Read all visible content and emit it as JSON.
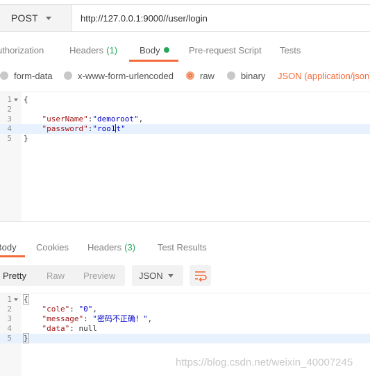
{
  "request": {
    "method": "POST",
    "url": "http://127.0.0.1:9000//user/login",
    "tabs": [
      {
        "label": "uthorization"
      },
      {
        "label": "Headers",
        "count": "(1)"
      },
      {
        "label": "Body"
      },
      {
        "label": "Pre-request Script"
      },
      {
        "label": "Tests"
      }
    ],
    "body_types": [
      "form-data",
      "x-www-form-urlencoded",
      "raw",
      "binary"
    ],
    "selected_body_type": "raw",
    "content_type": "JSON (application/json)",
    "editor": {
      "line_numbers": [
        "1",
        "2",
        "3",
        "4",
        "5"
      ],
      "brace_open": "{",
      "brace_close": "}",
      "user_key": "\"userName\"",
      "user_value": "\"demoroot\"",
      "pass_key": "\"password\"",
      "pass_value_before_cursor": "\"roo1",
      "pass_value_after_cursor": "t\""
    }
  },
  "response": {
    "tabs": [
      {
        "label": "Body"
      },
      {
        "label": "Cookies"
      },
      {
        "label": "Headers",
        "count": "(3)"
      },
      {
        "label": "Test Results"
      }
    ],
    "view_modes": [
      "Pretty",
      "Raw",
      "Preview"
    ],
    "format": "JSON",
    "editor": {
      "line_numbers": [
        "1",
        "2",
        "3",
        "4",
        "5"
      ],
      "brace_open": "{",
      "brace_close": "}",
      "cole_key": "\"cole\"",
      "cole_value": "\"0\"",
      "message_key": "\"message\"",
      "message_value": "\"密码不正确！\"",
      "data_key": "\"data\"",
      "data_value": "null"
    }
  },
  "watermark": "https://blog.csdn.net/weixin_40007245",
  "colors": {
    "accent": "#f26b3a",
    "count_green": "#26a65b",
    "json_key": "#a31515",
    "json_string": "#0000c8"
  }
}
